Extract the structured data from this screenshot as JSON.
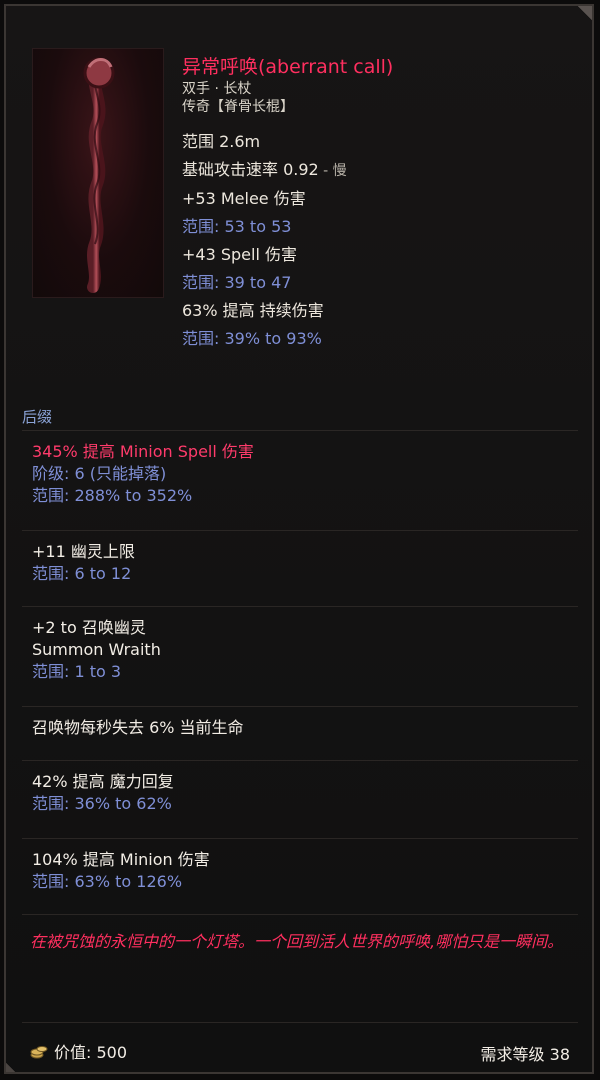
{
  "item": {
    "name": "异常呼唤(aberrant call)",
    "type": "双手 · 长杖",
    "rarity": "传奇【脊骨长棍】",
    "stats": [
      {
        "text": "范围 2.6m"
      },
      {
        "text": "基础攻击速率 0.92",
        "suffix": " - 慢"
      },
      {
        "text": "+53 Melee 伤害",
        "range": "范围: 53 to 53"
      },
      {
        "text": "+43 Spell 伤害",
        "range": "范围: 39 to 47"
      },
      {
        "text": "63% 提高 持续伤害",
        "range": "范围: 39% to 93%"
      }
    ]
  },
  "suffix": {
    "label": "后缀",
    "blocks": [
      {
        "line1": "345% 提高 Minion Spell 伤害",
        "line2": "阶级: 6 (只能掉落)",
        "line3": "范围: 288% to 352%"
      },
      {
        "line1": "+11 幽灵上限",
        "line2": "范围: 6 to 12"
      },
      {
        "line1": "+2 to 召唤幽灵",
        "line2": "Summon Wraith",
        "line3": "范围: 1 to 3"
      },
      {
        "line1": "召唤物每秒失去 6% 当前生命"
      },
      {
        "line1": "42% 提高 魔力回复",
        "line2": "范围: 36% to 62%"
      },
      {
        "line1": "104% 提高 Minion 伤害",
        "line2": "范围: 63% to 126%"
      }
    ]
  },
  "flavor": "在被咒蚀的永恒中的一个灯塔。一个回到活人世界的呼唤,哪怕只是一瞬间。",
  "footer": {
    "value_label": "价值: 500",
    "level_label": "需求等级 38",
    "coin_icon": "coin-stack-icon"
  },
  "colors": {
    "title": "#ff2f5f",
    "range": "#7f8fd6",
    "text": "#ede7dd"
  }
}
